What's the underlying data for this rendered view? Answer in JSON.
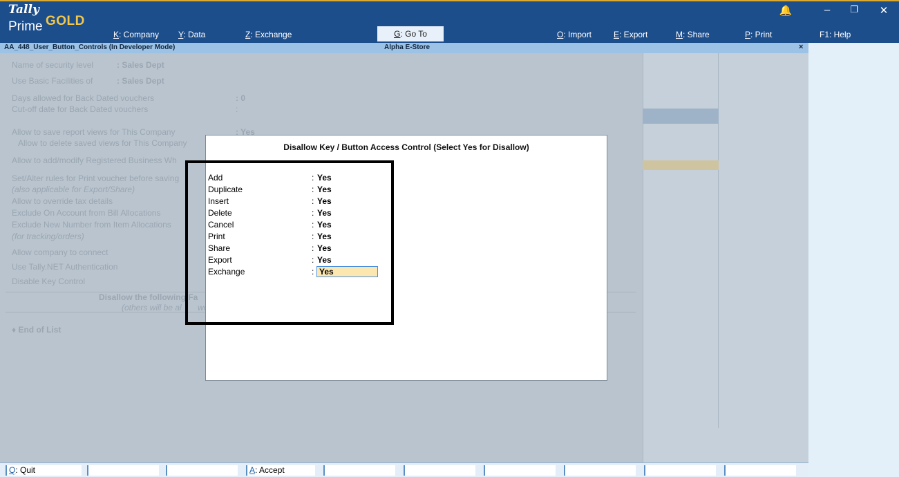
{
  "app": {
    "logo_tally": "Tally",
    "logo_gold": "GOLD",
    "logo_prime": "Prime"
  },
  "menu": {
    "company": {
      "key": "K",
      "label": ": Company"
    },
    "data": {
      "key": "Y",
      "label": ": Data"
    },
    "exchange": {
      "key": "Z",
      "label": ": Exchange"
    },
    "goto": {
      "key": "G",
      "label": ": Go To"
    },
    "import": {
      "key": "O",
      "label": ": Import"
    },
    "export": {
      "key": "E",
      "label": ": Export"
    },
    "share": {
      "key": "M",
      "label": ": Share"
    },
    "print": {
      "key": "P",
      "label": ": Print"
    },
    "help": {
      "label": "F1: Help"
    }
  },
  "window_controls": {
    "bell": "🔔",
    "minimize": "–",
    "restore": "❐",
    "close": "✕"
  },
  "title_strip": {
    "left": "AA_448_User_Button_Controls (In Developer Mode)",
    "center": "Alpha E-Store",
    "close": "×"
  },
  "background_form": {
    "security_level_label": "Name of security level",
    "security_level_value": ": Sales Dept",
    "basic_facilities_label": "Use Basic Facilities of",
    "basic_facilities_value": ": Sales Dept",
    "days_back_dated_label": "Days allowed for Back Dated vouchers",
    "days_back_dated_value": ": 0",
    "cutoff_date_label": "Cut-off date for Back Dated vouchers",
    "cutoff_date_value": ":",
    "save_views_label": "Allow to save report views for This Company",
    "save_views_value": ": Yes",
    "delete_views_label": "Allow to delete saved views for This Company",
    "add_modify_label": "Allow to add/modify Registered Business Wh",
    "print_rules_label": "Set/Alter rules for Print voucher before saving",
    "print_rules_note": "(also applicable for Export/Share)",
    "override_tax_label": "Allow to override tax details",
    "exclude_on_account_label": "Exclude On Account from Bill Allocations",
    "exclude_new_number_label": "Exclude New Number from Item Allocations",
    "tracking_note": "(for tracking/orders)",
    "allow_connect_label": "Allow company to connect",
    "tally_net_label": "Use Tally.NET Authentication",
    "disable_key_label": "Disable Key Control",
    "disallow_heading": "Disallow the following Fa",
    "others_note": "(others will be al",
    "others_note_tail": "wed",
    "end_of_list": "♦ End of List"
  },
  "dialog": {
    "title": "Disallow Key / Button Access Control (Select Yes for Disallow)",
    "options": [
      {
        "label": "Add",
        "value": "Yes"
      },
      {
        "label": "Duplicate",
        "value": "Yes"
      },
      {
        "label": "Insert",
        "value": "Yes"
      },
      {
        "label": "Delete",
        "value": "Yes"
      },
      {
        "label": "Cancel",
        "value": "Yes"
      },
      {
        "label": "Print",
        "value": "Yes"
      },
      {
        "label": "Share",
        "value": "Yes"
      },
      {
        "label": "Export",
        "value": "Yes"
      },
      {
        "label": "Exchange",
        "value": "Yes"
      }
    ],
    "colon": ":"
  },
  "bottom_bar": {
    "quit": {
      "key": "Q",
      "label": ": Quit"
    },
    "accept": {
      "key": "A",
      "label": ": Accept"
    }
  },
  "colors": {
    "topbar": "#1d4e8c",
    "gold": "#f2c84b",
    "active_field": "#fde7b1",
    "highlight_border": "#000000"
  }
}
